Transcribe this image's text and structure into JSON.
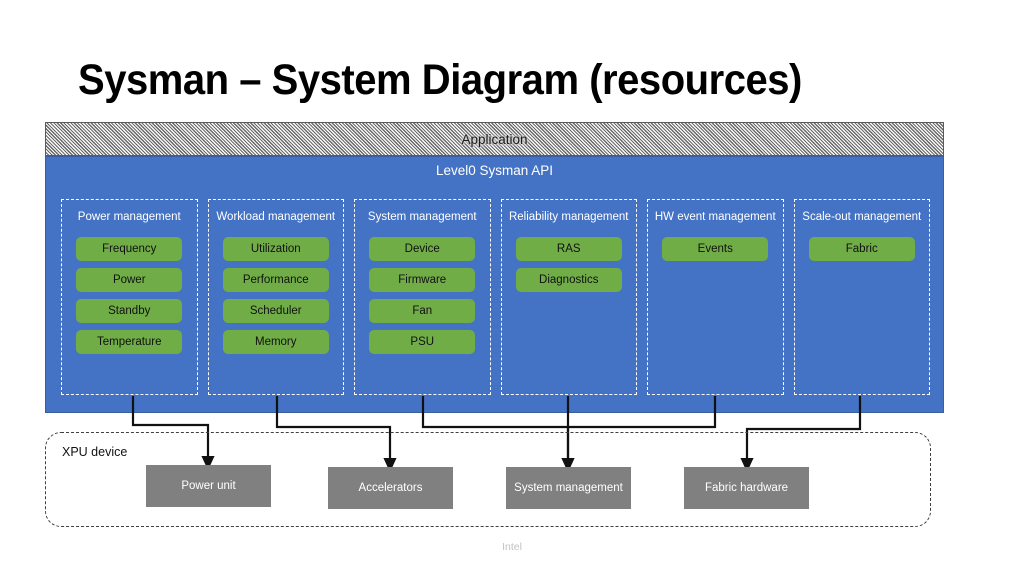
{
  "slide": {
    "title": "Sysman – System Diagram (resources)",
    "footer": "Intel"
  },
  "stack": {
    "application_label": "Application",
    "api_label": "Level0 Sysman API"
  },
  "colors": {
    "api_panel": "#4472C4",
    "chip": "#70AD47",
    "hardware_box": "#808080",
    "application_bar": "#b8b8b8"
  },
  "columns": [
    {
      "title": "Power management",
      "chips": [
        "Frequency",
        "Power",
        "Standby",
        "Temperature"
      ]
    },
    {
      "title": "Workload management",
      "chips": [
        "Utilization",
        "Performance",
        "Scheduler",
        "Memory"
      ]
    },
    {
      "title": "System management",
      "chips": [
        "Device",
        "Firmware",
        "Fan",
        "PSU"
      ]
    },
    {
      "title": "Reliability management",
      "chips": [
        "RAS",
        "Diagnostics"
      ]
    },
    {
      "title": "HW event management",
      "chips": [
        "Events"
      ]
    },
    {
      "title": "Scale-out management",
      "chips": [
        "Fabric"
      ]
    }
  ],
  "xpu": {
    "label": "XPU device",
    "hardware": [
      {
        "label": "Power unit"
      },
      {
        "label": "Accelerators"
      },
      {
        "label": "System management"
      },
      {
        "label": "Fabric hardware"
      }
    ]
  }
}
